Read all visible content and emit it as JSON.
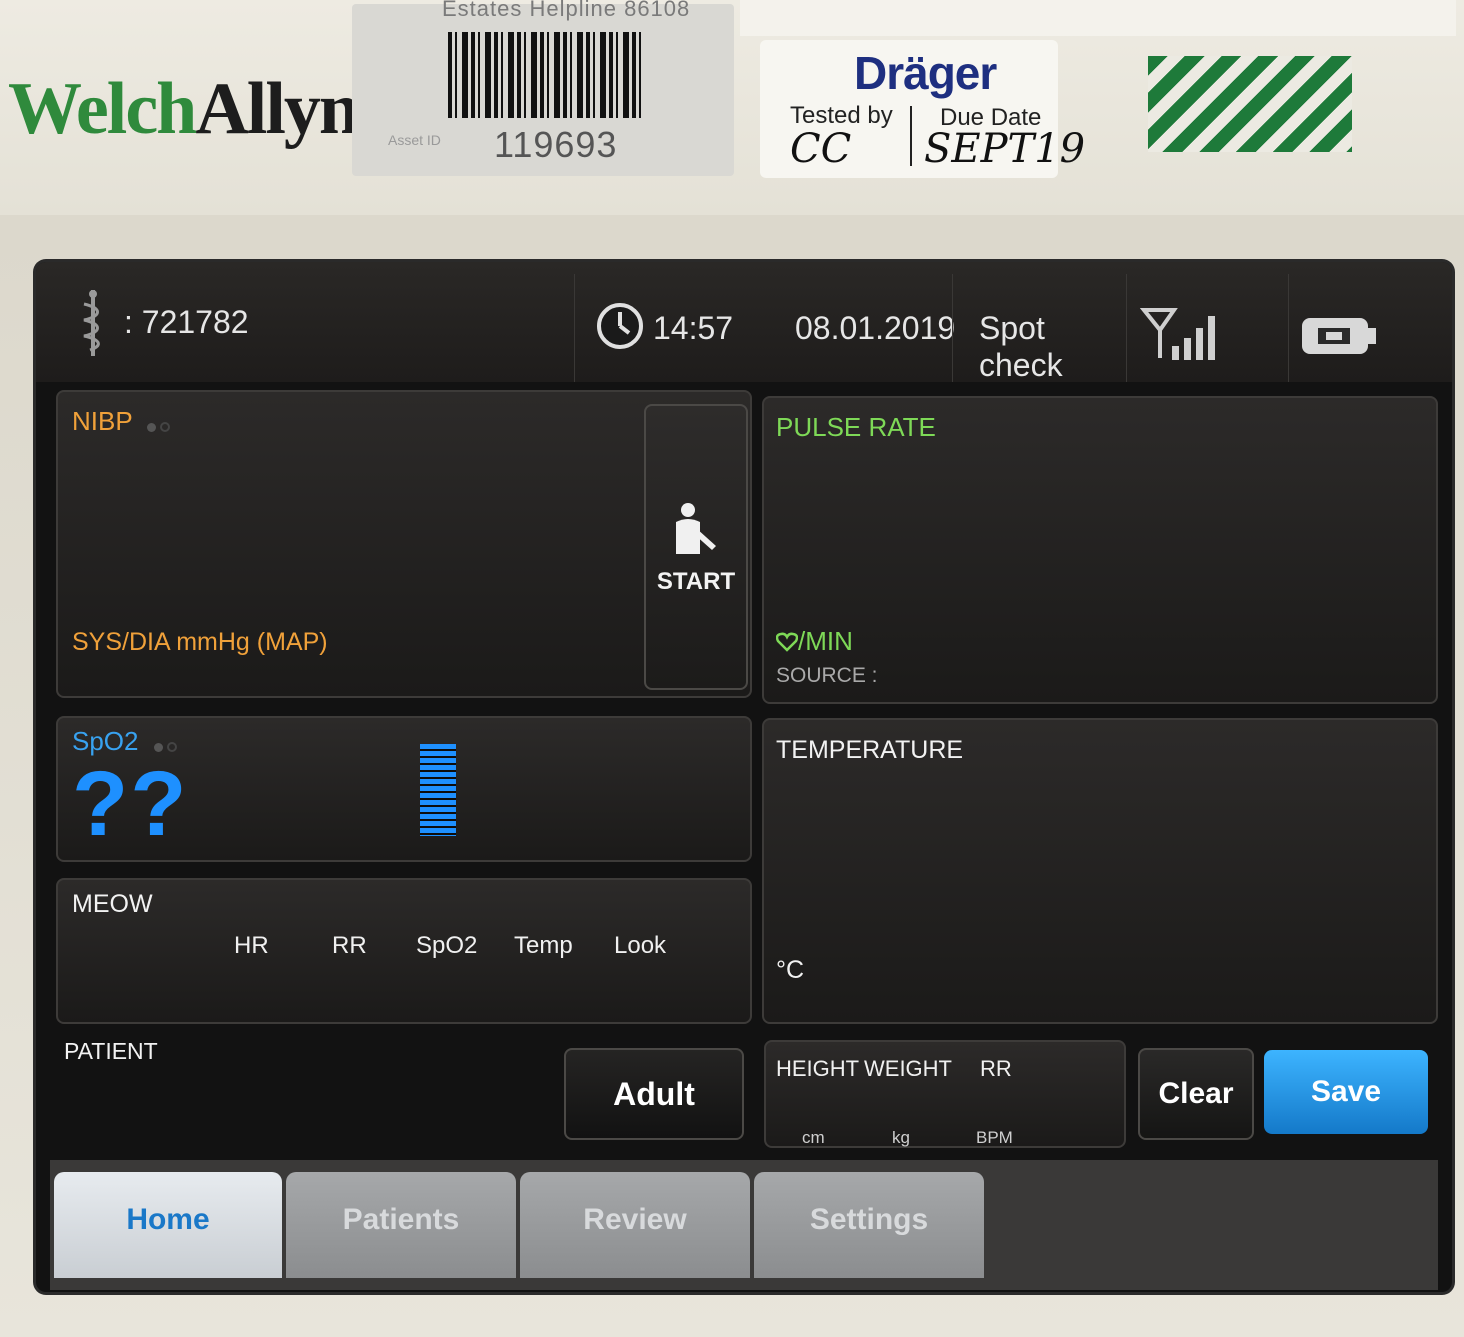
{
  "device": {
    "brand_part1": "Welch",
    "brand_part2": "Allyn",
    "asset_helpline": "Estates Helpline 86108",
    "asset_label": "Asset ID",
    "asset_number": "119693",
    "inspection_brand": "Dräger",
    "tested_by_label": "Tested by",
    "tested_by_value": "CC",
    "due_date_label": "Due Date",
    "due_date_value": "SEPT19",
    "colors": {
      "welch_green": "#2f8a3c",
      "drager_blue": "#1e2f80",
      "stripe_green": "#1e7a3a"
    }
  },
  "status_bar": {
    "clinician_prefix": ":",
    "clinician_id": "721782",
    "time": "14:57",
    "date": "08.01.2019",
    "mode": "Spot check",
    "icons": [
      "caduceus-icon",
      "clock-icon",
      "signal-icon",
      "battery-icon"
    ]
  },
  "nibp": {
    "title": "NIBP",
    "units": "SYS/DIA mmHg (MAP)",
    "start_label": "START",
    "color": "#f0a13a"
  },
  "pulse_rate": {
    "title": "PULSE RATE",
    "units": "/MIN",
    "source_label": "SOURCE :",
    "color": "#7ed957"
  },
  "spo2": {
    "title": "SpO2",
    "value": "??",
    "color": "#38a2f0"
  },
  "temperature": {
    "title": "TEMPERATURE",
    "units": "°C"
  },
  "meow": {
    "title": "MEOW",
    "columns": [
      "HR",
      "RR",
      "SpO2",
      "Temp",
      "Look"
    ]
  },
  "patient": {
    "title": "PATIENT",
    "type_button": "Adult"
  },
  "measurements": {
    "height_label": "HEIGHT",
    "height_unit": "cm",
    "weight_label": "WEIGHT",
    "weight_unit": "kg",
    "rr_label": "RR",
    "rr_unit": "BPM"
  },
  "actions": {
    "clear_label": "Clear",
    "save_label": "Save",
    "save_color": "#1e8fe6"
  },
  "tabs": [
    {
      "label": "Home",
      "active": true
    },
    {
      "label": "Patients",
      "active": false
    },
    {
      "label": "Review",
      "active": false
    },
    {
      "label": "Settings",
      "active": false
    }
  ]
}
